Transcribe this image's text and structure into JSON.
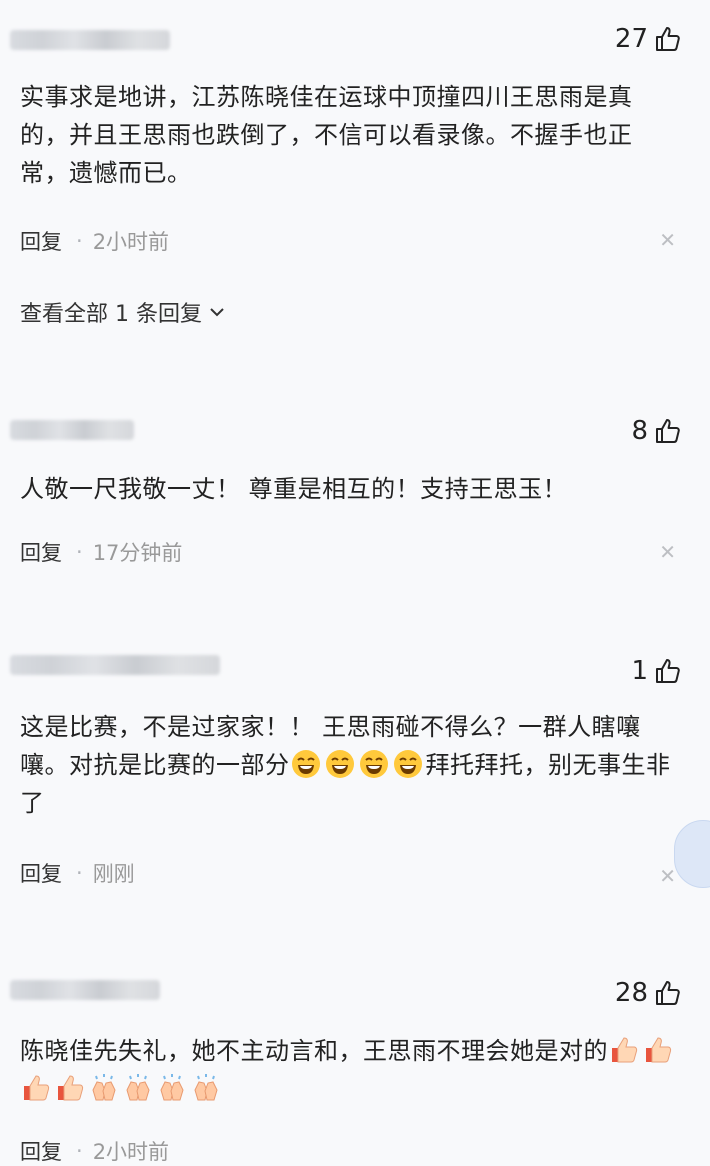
{
  "comments": [
    {
      "likes": "27",
      "text": "实事求是地讲，江苏陈晓佳在运球中顶撞四川王思雨是真的，并且王思雨也跌倒了，不信可以看录像。不握手也正常，遗憾而已。",
      "reply_label": "回复",
      "time": "2小时前",
      "view_replies": "查看全部 1 条回复"
    },
    {
      "likes": "8",
      "text": "人敬一尺我敬一丈！ 尊重是相互的！支持王思玉！",
      "reply_label": "回复",
      "time": "17分钟前"
    },
    {
      "likes": "1",
      "text_before_emoji": "这是比赛，不是过家家！！ 王思雨碰不得么？一群人瞎嚷嚷。对抗是比赛的一部分",
      "text_after_emoji": "拜托拜托，别无事生非了",
      "emoji": [
        "laughing-face-emoji",
        "laughing-face-emoji",
        "laughing-face-emoji",
        "laughing-face-emoji"
      ],
      "reply_label": "回复",
      "time": "刚刚"
    },
    {
      "likes": "28",
      "text": "陈晓佳先失礼，她不主动言和，王思雨不理会她是对的",
      "emoji": [
        "thumbs-up-emoji",
        "thumbs-up-emoji",
        "thumbs-up-emoji",
        "thumbs-up-emoji",
        "clapping-hands-emoji",
        "clapping-hands-emoji",
        "clapping-hands-emoji",
        "clapping-hands-emoji"
      ],
      "reply_label": "回复",
      "time": "2小时前"
    }
  ],
  "colors": {
    "background": "#f8f9fb",
    "text": "#222222",
    "meta": "#999999"
  }
}
